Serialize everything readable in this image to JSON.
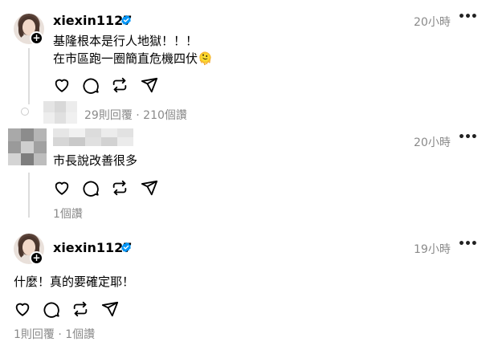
{
  "post1": {
    "username": "xiexin1127",
    "time": "20小時",
    "line1": "基隆根本是行人地獄！！！",
    "line2": "在市區跑一圈簡直危機四伏🫠",
    "replies_meta": "29則回覆 · 210個讚"
  },
  "post2": {
    "time": "20小時",
    "text": "市長說改善很多",
    "meta": "1個讚"
  },
  "post3": {
    "username": "xiexin1127",
    "time": "19小時",
    "text": "什麼！真的要確定耶！",
    "meta": "1則回覆 · 1個讚"
  },
  "icons": {
    "like": "heart-icon",
    "comment": "comment-icon",
    "repost": "repost-icon",
    "share": "share-icon",
    "verified": "verified-badge-icon",
    "more": "more-options-icon"
  },
  "colors": {
    "verified": "#0095f6",
    "muted": "#8a8a8a",
    "thread_line": "#dcdcdc"
  }
}
